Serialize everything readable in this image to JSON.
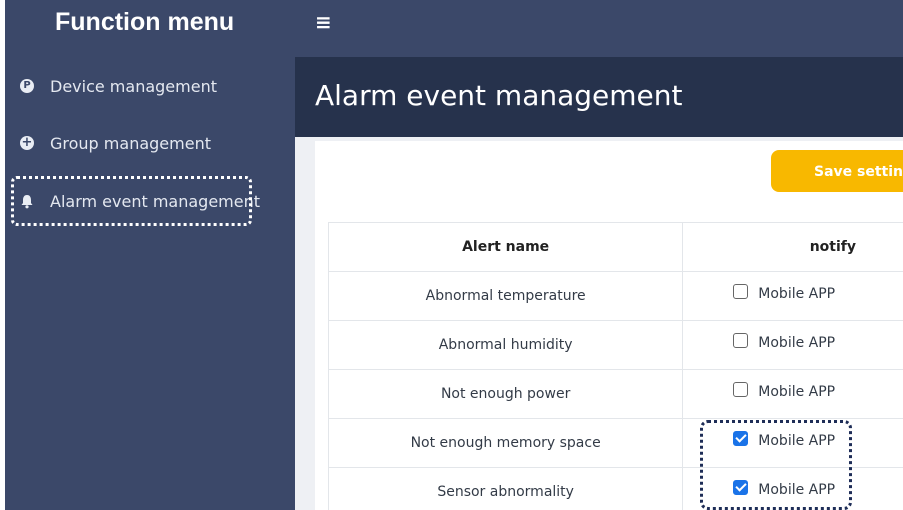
{
  "sidebar": {
    "title": "Function menu",
    "items": [
      {
        "label": "Device management",
        "icon": "p-circle-icon",
        "glyph": "P"
      },
      {
        "label": "Group management",
        "icon": "plus-circle-icon",
        "glyph": "+"
      },
      {
        "label": "Alarm event management",
        "icon": "bell-icon",
        "glyph": "🔔"
      }
    ]
  },
  "topbar": {
    "menu_glyph": "≡"
  },
  "page": {
    "title": "Alarm event management"
  },
  "toolbar": {
    "save_label": "Save settings"
  },
  "table": {
    "headers": {
      "name": "Alert name",
      "notify": "notify"
    },
    "rows": [
      {
        "name": "Abnormal temperature",
        "option": "Mobile APP",
        "checked": false
      },
      {
        "name": "Abnormal humidity",
        "option": "Mobile APP",
        "checked": false
      },
      {
        "name": "Not enough power",
        "option": "Mobile APP",
        "checked": false
      },
      {
        "name": "Not enough memory space",
        "option": "Mobile APP",
        "checked": true
      },
      {
        "name": "Sensor abnormality",
        "option": "Mobile APP",
        "checked": true
      }
    ]
  },
  "colors": {
    "sidebar_bg": "#3b4869",
    "title_bar_bg": "#26324c",
    "save_button": "#f8b800",
    "checkbox_checked": "#1a73e8"
  }
}
